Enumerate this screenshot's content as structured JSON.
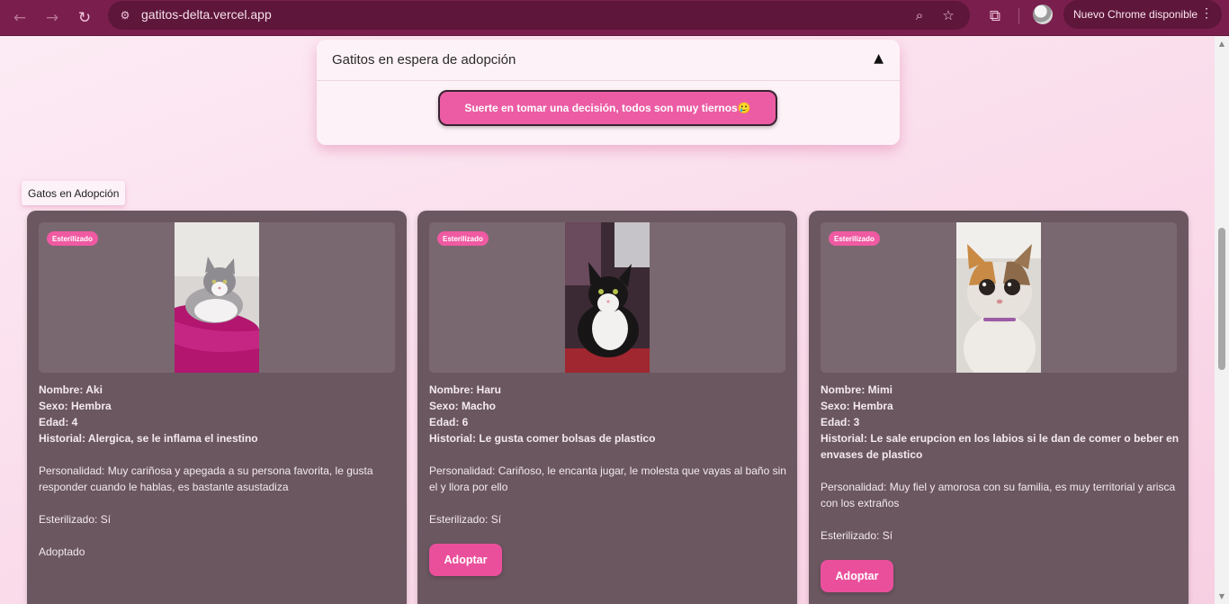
{
  "browser": {
    "url": "gatitos-delta.vercel.app",
    "update_label": "Nuevo Chrome disponible"
  },
  "accordion": {
    "title": "Gatitos en espera de adopción",
    "toggle": "▲",
    "button_label": "Suerte en tomar una decisión, todos son muy tiernos🥲"
  },
  "section": {
    "label": "Gatos en Adopción"
  },
  "cats": [
    {
      "badge": "Esterilizado",
      "nombre": "Nombre: Aki",
      "sexo": "Sexo: Hembra",
      "edad": "Edad: 4",
      "historial": "Historial: Alergica, se le inflama el inestino",
      "personalidad": "Personalidad: Muy cariñosa y apegada a su persona favorita, le gusta responder cuando le hablas, es bastante asustadiza",
      "esterilizado": "Esterilizado: Sí",
      "status": "Adoptado"
    },
    {
      "badge": "Esterilizado",
      "nombre": "Nombre: Haru",
      "sexo": "Sexo: Macho",
      "edad": "Edad: 6",
      "historial": "Historial: Le gusta comer bolsas de plastico",
      "personalidad": "Personalidad: Cariñoso, le encanta jugar, le molesta que vayas al baño sin el y llora por ello",
      "esterilizado": "Esterilizado: Sí",
      "button": "Adoptar"
    },
    {
      "badge": "Esterilizado",
      "nombre": "Nombre: Mimi",
      "sexo": "Sexo: Hembra",
      "edad": "Edad: 3",
      "historial": "Historial: Le sale erupcion en los labios si le dan de comer o beber en envases de plastico",
      "personalidad": "Personalidad: Muy fiel y amorosa con su familia, es muy territorial y arisca con los extraños",
      "esterilizado": "Esterilizado: Sí",
      "button": "Adoptar"
    }
  ]
}
